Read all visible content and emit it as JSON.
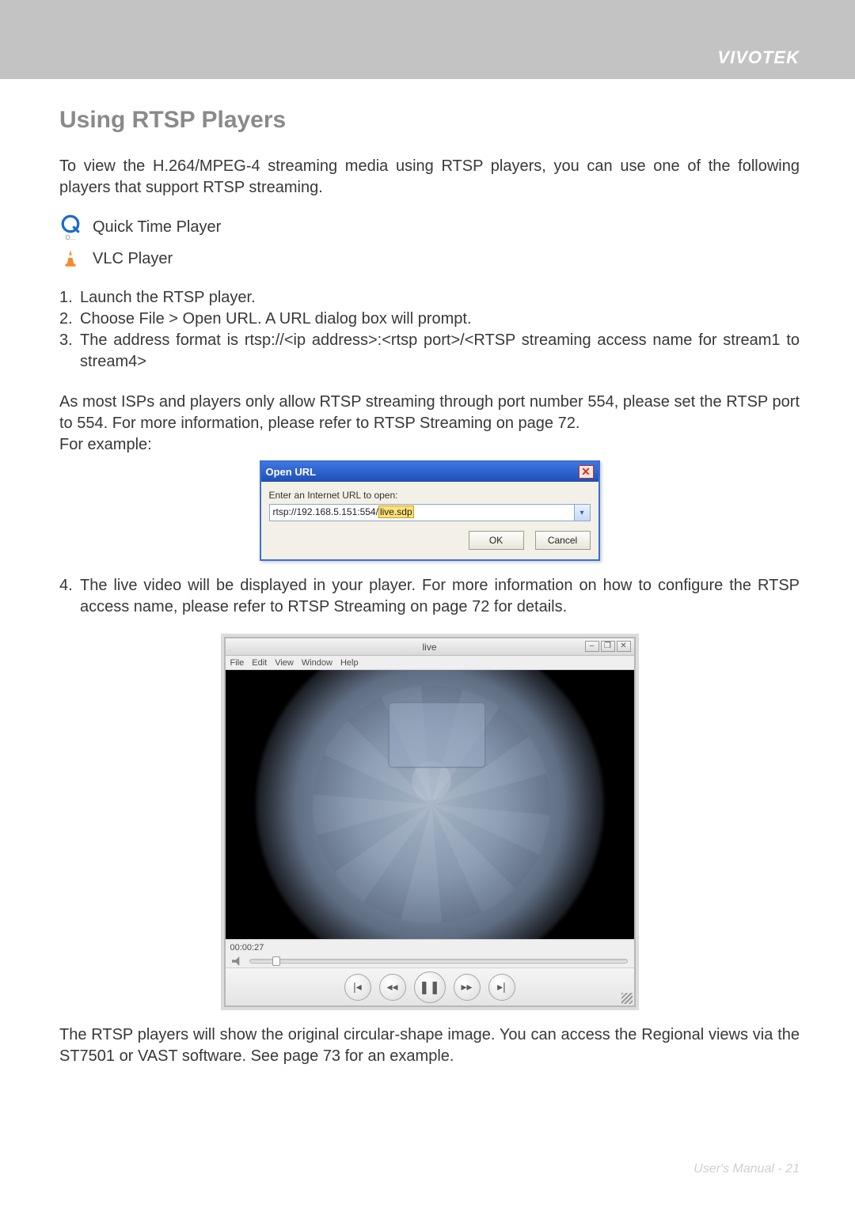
{
  "brand": "VIVOTEK",
  "heading": "Using RTSP Players",
  "intro": "To view the H.264/MPEG-4 streaming media using RTSP players, you can use one of the following players that support RTSP streaming.",
  "players": {
    "qt": "Quick Time Player",
    "vlc": "VLC Player"
  },
  "steps": {
    "s1": "Launch the RTSP player.",
    "s2": "Choose File > Open URL. A URL dialog box will prompt.",
    "s3": "The address format is rtsp://<ip address>:<rtsp port>/<RTSP streaming access name for stream1 to stream4>"
  },
  "mid_para": "As most ISPs and players only allow RTSP streaming through port number 554, please set the RTSP port to 554. For more information, please refer to RTSP Streaming on page 72.",
  "for_example": "For example:",
  "openurl": {
    "title": "Open URL",
    "label": "Enter an Internet URL to open:",
    "value_prefix": "rtsp://192.168.5.151:554/",
    "value_hl": "live.sdp",
    "ok": "OK",
    "cancel": "Cancel",
    "close_glyph": "✕"
  },
  "step4": "The live video will be displayed in your player. For more information on how to configure the RTSP access name, please refer to RTSP Streaming on page 72 for details.",
  "player_window": {
    "title": "live",
    "menu": [
      "File",
      "Edit",
      "View",
      "Window",
      "Help"
    ],
    "timecode": "00:00:27",
    "controls": {
      "rewind_full": "|◂",
      "rewind": "◂◂",
      "pause": "❚❚",
      "forward": "▸▸",
      "forward_full": "▸|"
    },
    "win_min": "–",
    "win_max": "❐",
    "win_close": "✕"
  },
  "closing": "The RTSP players will show the original circular-shape image. You can access the Regional views via the ST7501 or VAST software. See page 73 for an example.",
  "footer_label": "User's Manual - ",
  "footer_page": "21"
}
